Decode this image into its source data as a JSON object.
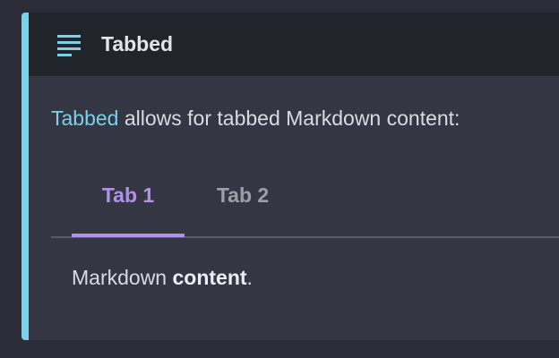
{
  "admonition": {
    "title": "Tabbed",
    "icon": "document-lines-icon",
    "accent_color": "#7ad1e8"
  },
  "intro": {
    "link_text": "Tabbed",
    "rest_text": " allows for tabbed Markdown content:"
  },
  "tabs": {
    "items": [
      {
        "label": "Tab 1",
        "active": true
      },
      {
        "label": "Tab 2",
        "active": false
      }
    ],
    "active_color": "#b291eb"
  },
  "tab_content": {
    "text_before": "Markdown ",
    "bold_text": "content",
    "text_after": "."
  }
}
